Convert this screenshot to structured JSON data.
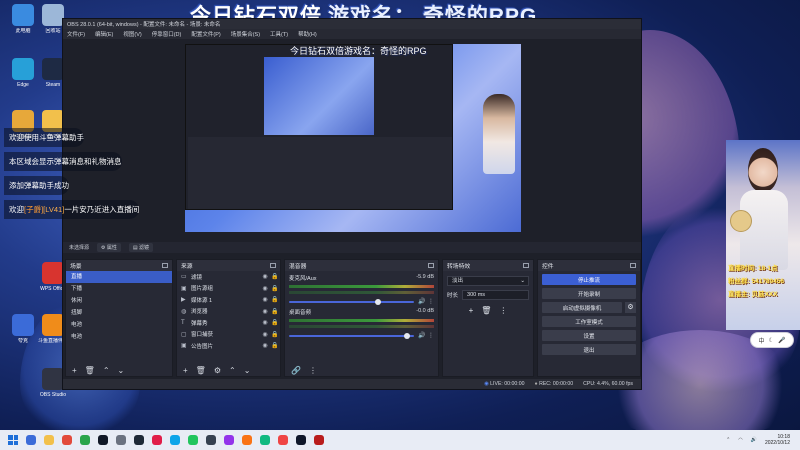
{
  "overlay": {
    "title_left": "今日钻石双倍",
    "title_right": "游戏名：  奇怪的RPG",
    "preview_title": "今日钻石双倍游戏名：奇怪的RPG"
  },
  "desktop_icons": [
    {
      "label": "此电脑",
      "color": "#3a8be0"
    },
    {
      "label": "回收站",
      "color": "#9cb7d8"
    },
    {
      "label": "Edge",
      "color": "#27a0d8"
    },
    {
      "label": "控制面板",
      "color": "#e7a83a"
    },
    {
      "label": "Steam",
      "color": "#1e2a44"
    },
    {
      "label": "文件夹",
      "color": "#f2c04b"
    },
    {
      "label": "WPS Office",
      "color": "#d8342f"
    },
    {
      "label": "夸克",
      "color": "#3b6bd8"
    },
    {
      "label": "斗鱼直播伴侣",
      "color": "#f08c1a"
    },
    {
      "label": "OBS Studio",
      "color": "#303443"
    }
  ],
  "obs": {
    "window_title": "OBS 28.0.1 (64-bit, windows) - 配置文件: 未命名 - 场景: 未命名",
    "menu": [
      "文件(F)",
      "编辑(E)",
      "视图(V)",
      "停靠窗口(D)",
      "配置文件(P)",
      "场景集合(S)",
      "工具(T)",
      "帮助(H)"
    ],
    "status_strip": {
      "label": "未选择源",
      "props": "属性",
      "filters": "滤镜"
    },
    "scenes": {
      "title": "场景",
      "items": [
        "直播",
        "下播",
        "休闲",
        "扭脚",
        "电池",
        "电池"
      ],
      "selected_index": 0
    },
    "sources": {
      "title": "来源",
      "items": [
        {
          "name": "滤镜",
          "icon": "monitor-icon"
        },
        {
          "name": "图片源组",
          "icon": "image-icon"
        },
        {
          "name": "媒体源 1",
          "icon": "media-icon"
        },
        {
          "name": "浏览器",
          "icon": "browser-icon"
        },
        {
          "name": "弹幕秀",
          "icon": "text-icon"
        },
        {
          "name": "窗口捕获",
          "icon": "window-icon"
        },
        {
          "name": "公告图片",
          "icon": "image-icon"
        }
      ]
    },
    "mixer": {
      "title": "混音器",
      "channels": [
        {
          "name": "麦克风/Aux",
          "db": "-5.9 dB",
          "level": 0.71
        },
        {
          "name": "桌面音频",
          "db": "-0.0 dB",
          "level": 0.94
        }
      ]
    },
    "transitions": {
      "title": "转场特效",
      "type": "淡出",
      "duration_label": "时长",
      "duration": "300 ms"
    },
    "controls": {
      "title": "控件",
      "stop_stream": "停止推流",
      "start_record": "开始录制",
      "virtual_cam": "启动虚拟摄像机",
      "studio_mode": "工作室模式",
      "settings": "设置",
      "exit": "退出"
    },
    "statusbar": {
      "live": "LIVE: 00:00:00",
      "rec": "REC: 00:00:00",
      "cpu": "CPU: 4.4%, 60.00 fps"
    }
  },
  "chat": [
    {
      "text": "欢迎使用斗鱼弹幕助手"
    },
    {
      "text": "本区域会显示弹幕消息和礼物消息"
    },
    {
      "text": "添加弹幕助手成功"
    },
    {
      "prefix": "欢迎",
      "badge": "[子爵]",
      "level": "[LV41]",
      "text": "一片安乃近进入直播间"
    }
  ],
  "side_info": [
    "直播时间: 18-1点",
    "粉丝群: 541789456",
    "直播主: 贝兹XXX"
  ],
  "mini_chip": "中",
  "taskbar": {
    "time": "10:18",
    "date": "2022/10/12",
    "apps": [
      "#3b6bd8",
      "#f2c04b",
      "#e24a3b",
      "#2aa54b",
      "#111827",
      "#6b7280",
      "#1f2937",
      "#e11d48",
      "#0ea5e9",
      "#22c55e",
      "#374151",
      "#9333ea",
      "#f97316",
      "#10b981",
      "#ef4444",
      "#0f172a",
      "#b91c1c"
    ]
  }
}
